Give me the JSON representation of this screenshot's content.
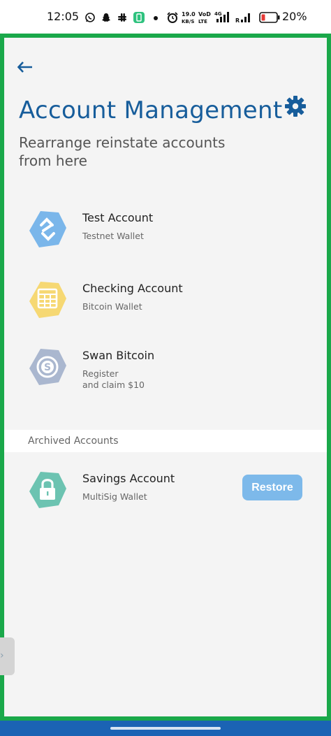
{
  "status_bar": {
    "time": "12:05",
    "net_speed_value": "19.0",
    "net_speed_unit": "KB/S",
    "volte_top": "VoD",
    "volte_bottom": "LTE",
    "battery_percent": "20%",
    "icons": [
      "whatsapp-icon",
      "snapchat-icon",
      "slack-icon",
      "app-icon",
      "dot-icon",
      "alarm-icon",
      "vibrate-icon",
      "signal-icon",
      "roaming-signal-icon",
      "battery-icon"
    ]
  },
  "header": {
    "back_icon": "arrow-left-icon",
    "title": "Account Management",
    "subtitle": "Rearrange reinstate accounts from here",
    "settings_icon": "gear-icon"
  },
  "accounts": [
    {
      "name": "Test Account",
      "type": "Testnet Wallet",
      "icon": "test-wallet-icon",
      "color": "#7ab6ea"
    },
    {
      "name": "Checking Account",
      "type": "Bitcoin Wallet",
      "icon": "calculator-icon",
      "color": "#f6d873"
    },
    {
      "name": "Swan Bitcoin",
      "type": "Register\nand claim $10",
      "icon": "swan-icon",
      "color": "#aab7cf"
    }
  ],
  "archived": {
    "section_label": "Archived Accounts",
    "accounts": [
      {
        "name": "Savings Account",
        "type": "MultiSig Wallet",
        "icon": "lock-icon",
        "color": "#6cc3b1",
        "action_label": "Restore"
      }
    ]
  },
  "colors": {
    "accent": "#175d9b",
    "frame_border": "#1aa84a",
    "restore_button": "#7db9ea",
    "nav_bar": "#1b63b4"
  }
}
